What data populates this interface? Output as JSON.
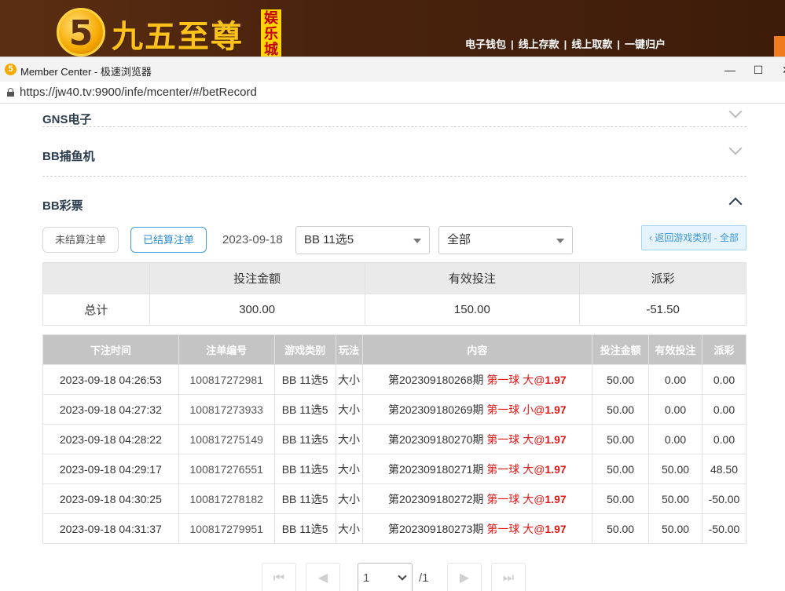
{
  "site": {
    "logo_glyph": "5",
    "logo_text": "九五至尊",
    "logo_tag": "娱乐城",
    "nav": [
      "电子钱包",
      "线上存款",
      "线上取款",
      "一键归户"
    ],
    "nav_sep": "|"
  },
  "window": {
    "title": "Member Center - 极速浏览器",
    "icon_glyph": "5",
    "url": "https://jw40.tv:9900/infe/mcenter/#/betRecord",
    "controls": {
      "minimize": "—",
      "maximize": "☐",
      "close": "✕"
    }
  },
  "sections": [
    {
      "title": "GNS电子",
      "expanded": false
    },
    {
      "title": "BB捕鱼机",
      "expanded": false
    },
    {
      "title": "BB彩票",
      "expanded": true
    }
  ],
  "filters": {
    "unsettled_label": "未结算注单",
    "settled_label": "已结算注单",
    "date": "2023-09-18",
    "game_select": "BB 11选5",
    "type_select": "全部",
    "back_label": "‹ 返回游戏类别 - 全部"
  },
  "summary": {
    "headers": [
      "投注金额",
      "有效投注",
      "派彩"
    ],
    "row_label": "总计",
    "values": [
      "300.00",
      "150.00",
      "-51.50"
    ]
  },
  "records": {
    "headers": [
      "下注时间",
      "注单编号",
      "游戏类别",
      "玩法",
      "内容",
      "投注金额",
      "有效投注",
      "派彩"
    ],
    "rows": [
      {
        "time": "2023-09-18 04:26:53",
        "order": "100817272981",
        "game": "BB 11选5",
        "play": "大小",
        "period": "第202309180268期",
        "pick": "第一球 大",
        "at": "@",
        "odds": "1.97",
        "bet": "50.00",
        "valid": "0.00",
        "payout": "0.00"
      },
      {
        "time": "2023-09-18 04:27:32",
        "order": "100817273933",
        "game": "BB 11选5",
        "play": "大小",
        "period": "第202309180269期",
        "pick": "第一球 小",
        "at": "@",
        "odds": "1.97",
        "bet": "50.00",
        "valid": "0.00",
        "payout": "0.00"
      },
      {
        "time": "2023-09-18 04:28:22",
        "order": "100817275149",
        "game": "BB 11选5",
        "play": "大小",
        "period": "第202309180270期",
        "pick": "第一球 大",
        "at": "@",
        "odds": "1.97",
        "bet": "50.00",
        "valid": "0.00",
        "payout": "0.00"
      },
      {
        "time": "2023-09-18 04:29:17",
        "order": "100817276551",
        "game": "BB 11选5",
        "play": "大小",
        "period": "第202309180271期",
        "pick": "第一球 大",
        "at": "@",
        "odds": "1.97",
        "bet": "50.00",
        "valid": "50.00",
        "payout": "48.50"
      },
      {
        "time": "2023-09-18 04:30:25",
        "order": "100817278182",
        "game": "BB 11选5",
        "play": "大小",
        "period": "第202309180272期",
        "pick": "第一球 大",
        "at": "@",
        "odds": "1.97",
        "bet": "50.00",
        "valid": "50.00",
        "payout": "-50.00"
      },
      {
        "time": "2023-09-18 04:31:37",
        "order": "100817279951",
        "game": "BB 11选5",
        "play": "大小",
        "period": "第202309180273期",
        "pick": "第一球 大",
        "at": "@",
        "odds": "1.97",
        "bet": "50.00",
        "valid": "50.00",
        "payout": "-50.00"
      }
    ]
  },
  "pagination": {
    "first": "⏮",
    "prev": "◀",
    "current": "1",
    "total": "/1",
    "next": "▶",
    "last": "⏭"
  },
  "colors": {
    "header_bg": "#4a230d",
    "logo_gold": "#ffc21a",
    "accent_blue": "#2a8bd0",
    "negative_red": "#e84a4a",
    "table_header_grey": "#c4c4c4"
  }
}
